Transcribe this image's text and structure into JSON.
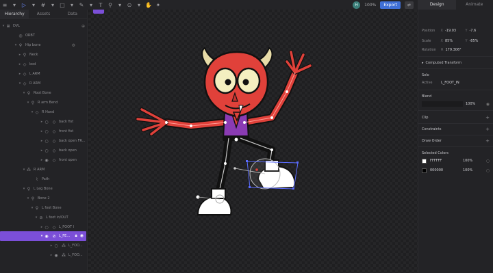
{
  "toolbar": {
    "avatar_initial": "H",
    "zoom": "100%",
    "export_label": "Export",
    "share_label": "⇄"
  },
  "left_panel": {
    "tabs": [
      {
        "label": "Hierarchy"
      },
      {
        "label": "Assets"
      },
      {
        "label": "Data"
      }
    ],
    "tree": [
      {
        "label": "DVL"
      },
      {
        "label": "ORBT"
      },
      {
        "label": "Hip bone"
      },
      {
        "label": "Neck"
      },
      {
        "label": "bod"
      },
      {
        "label": "L ARM"
      },
      {
        "label": "R ARM"
      },
      {
        "label": "Root Bone"
      },
      {
        "label": "R arm Bend"
      },
      {
        "label": "R Hand"
      },
      {
        "label": "back fist"
      },
      {
        "label": "front fist"
      },
      {
        "label": "back open FR..."
      },
      {
        "label": "back open"
      },
      {
        "label": "front open"
      },
      {
        "label": "R ARM"
      },
      {
        "label": "Path"
      },
      {
        "label": "L Leg Bone"
      },
      {
        "label": "Bone 2"
      },
      {
        "label": "L foot Bone"
      },
      {
        "label": "L foot in/OUT"
      },
      {
        "label": "L_FOOT l"
      },
      {
        "label": "L_FE..."
      },
      {
        "label": "L_FOO..."
      },
      {
        "label": "L_FOO..."
      }
    ]
  },
  "right_panel": {
    "tabs": [
      {
        "label": "Design"
      },
      {
        "label": "Animate"
      }
    ],
    "position_label": "Position",
    "position_x_key": "X",
    "position_x": "-19.03",
    "position_y_key": "Y",
    "position_y": "-7.6",
    "scale_label": "Scale",
    "scale_x_key": "X",
    "scale_x": "85%",
    "scale_y_key": "Y",
    "scale_y": "-85%",
    "rotation_label": "Rotation",
    "rotation_key": "R",
    "rotation": "179.306°",
    "computed_transform": "Computed Transform",
    "solo_label": "Solo",
    "solo_active_label": "Active",
    "solo_active_value": "L_FOOT_IN",
    "blend_label": "Blend",
    "blend_value": "100%",
    "clip_label": "Clip",
    "constraints_label": "Constraints",
    "draw_order_label": "Draw Order",
    "selected_colors_label": "Selected Colors",
    "colors": [
      {
        "hex": "FFFFFF",
        "opacity": "100%",
        "swatch": "#ffffff"
      },
      {
        "hex": "000000",
        "opacity": "100%",
        "swatch": "#000000"
      }
    ]
  },
  "colors": {
    "accent": "#7b4fd8",
    "export": "#3f6fd6",
    "devil_red": "#e0413a",
    "vest_purple": "#8a3bb3",
    "horn": "#e8dca8"
  }
}
